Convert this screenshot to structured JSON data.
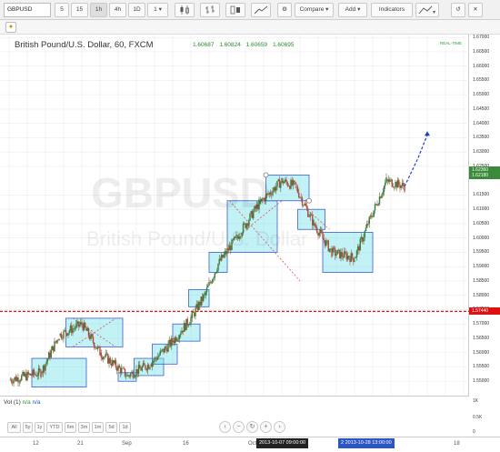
{
  "toolbar": {
    "symbol": "GBPUSD",
    "intervals": [
      "5",
      "15",
      "1h",
      "4h",
      "1D"
    ],
    "active_interval": "1h",
    "interval_dropdown": "1",
    "compare_label": "Compare",
    "add_label": "Add",
    "indicators_label": "Indicators"
  },
  "legend": {
    "title": "British Pound/U.S. Dollar, 60, FXCM",
    "values": [
      "1.60687",
      "1.60824",
      "1.60659",
      "1.60695"
    ],
    "realtime": "REAL-TIME"
  },
  "watermark": {
    "symbol": "GBPUSD",
    "description": "British Pound/U.S. Dollar"
  },
  "price_axis": {
    "ticks": [
      "1.67000",
      "1.66500",
      "1.66000",
      "1.65500",
      "1.65000",
      "1.64500",
      "1.64000",
      "1.63500",
      "1.63000",
      "1.62500",
      "1.61500",
      "1.61000",
      "1.60500",
      "1.60000",
      "1.59500",
      "1.59000",
      "1.58500",
      "1.58000",
      "1.57500",
      "1.57000",
      "1.56500",
      "1.56000",
      "1.55500",
      "1.55000"
    ],
    "current_high": "1.62360",
    "current_price": "1.62180",
    "level_price": "1.57440",
    "colors": {
      "current": "#3a8a3a",
      "level": "#dd1111"
    }
  },
  "volume": {
    "label": "Vol (1)",
    "val1": "n/a",
    "val2": "n/a",
    "axis_ticks": [
      "1K",
      "0.5K",
      "0"
    ]
  },
  "range_buttons": [
    "All",
    "5y",
    "1y",
    "YTD",
    "6m",
    "3m",
    "1m",
    "5d",
    "1d"
  ],
  "time_axis": {
    "labels": [
      {
        "text": "12",
        "x": 36
      },
      {
        "text": "21",
        "x": 85
      },
      {
        "text": "Sep",
        "x": 134
      },
      {
        "text": "16",
        "x": 201
      },
      {
        "text": "Oct",
        "x": 273
      },
      {
        "text": "18",
        "x": 499
      }
    ],
    "mark_left": "2013-10-07 09:00:00",
    "mark_right": "2 2013-10-28 13:00:00"
  },
  "chart_data": {
    "type": "candlestick",
    "symbol": "GBPUSD",
    "interval": "60",
    "source": "FXCM",
    "ylim": [
      1.545,
      1.671
    ],
    "segments": [
      {
        "from": [
          0,
          1.5505
        ],
        "to": [
          14,
          1.553
        ]
      },
      {
        "from": [
          14,
          1.553
        ],
        "to": [
          22,
          1.566
        ]
      },
      {
        "from": [
          22,
          1.566
        ],
        "to": [
          32,
          1.57
        ]
      },
      {
        "from": [
          32,
          1.57
        ],
        "to": [
          40,
          1.56
        ]
      },
      {
        "from": [
          40,
          1.56
        ],
        "to": [
          52,
          1.552
        ]
      },
      {
        "from": [
          52,
          1.552
        ],
        "to": [
          62,
          1.556
        ]
      },
      {
        "from": [
          62,
          1.556
        ],
        "to": [
          72,
          1.564
        ]
      },
      {
        "from": [
          72,
          1.564
        ],
        "to": [
          80,
          1.572
        ]
      },
      {
        "from": [
          80,
          1.572
        ],
        "to": [
          86,
          1.58
        ]
      },
      {
        "from": [
          86,
          1.58
        ],
        "to": [
          92,
          1.591
        ]
      },
      {
        "from": [
          92,
          1.591
        ],
        "to": [
          100,
          1.6
        ]
      },
      {
        "from": [
          100,
          1.6
        ],
        "to": [
          110,
          1.612
        ]
      },
      {
        "from": [
          110,
          1.612
        ],
        "to": [
          120,
          1.62
        ]
      },
      {
        "from": [
          120,
          1.62
        ],
        "to": [
          126,
          1.618
        ]
      },
      {
        "from": [
          126,
          1.618
        ],
        "to": [
          134,
          1.605
        ]
      },
      {
        "from": [
          134,
          1.605
        ],
        "to": [
          142,
          1.595
        ]
      },
      {
        "from": [
          142,
          1.595
        ],
        "to": [
          152,
          1.593
        ]
      },
      {
        "from": [
          152,
          1.593
        ],
        "to": [
          158,
          1.605
        ]
      },
      {
        "from": [
          158,
          1.605
        ],
        "to": [
          166,
          1.62
        ]
      },
      {
        "from": [
          166,
          1.62
        ],
        "to": [
          174,
          1.618
        ]
      }
    ],
    "projection": [
      [
        174,
        1.618
      ],
      [
        180,
        1.628
      ],
      [
        184,
        1.636
      ]
    ],
    "boxes": [
      {
        "x0": 10,
        "x1": 34,
        "y0": 1.548,
        "y1": 1.558
      },
      {
        "x0": 25,
        "x1": 50,
        "y0": 1.562,
        "y1": 1.572
      },
      {
        "x0": 48,
        "x1": 56,
        "y0": 1.55,
        "y1": 1.553
      },
      {
        "x0": 55,
        "x1": 68,
        "y0": 1.552,
        "y1": 1.558
      },
      {
        "x0": 63,
        "x1": 74,
        "y0": 1.556,
        "y1": 1.563
      },
      {
        "x0": 72,
        "x1": 84,
        "y0": 1.564,
        "y1": 1.57
      },
      {
        "x0": 79,
        "x1": 88,
        "y0": 1.576,
        "y1": 1.582
      },
      {
        "x0": 88,
        "x1": 96,
        "y0": 1.588,
        "y1": 1.595
      },
      {
        "x0": 96,
        "x1": 118,
        "y0": 1.595,
        "y1": 1.613
      },
      {
        "x0": 113,
        "x1": 132,
        "y0": 1.613,
        "y1": 1.622
      },
      {
        "x0": 127,
        "x1": 139,
        "y0": 1.603,
        "y1": 1.61
      },
      {
        "x0": 138,
        "x1": 160,
        "y0": 1.588,
        "y1": 1.602
      }
    ],
    "level_line": 1.5744
  }
}
